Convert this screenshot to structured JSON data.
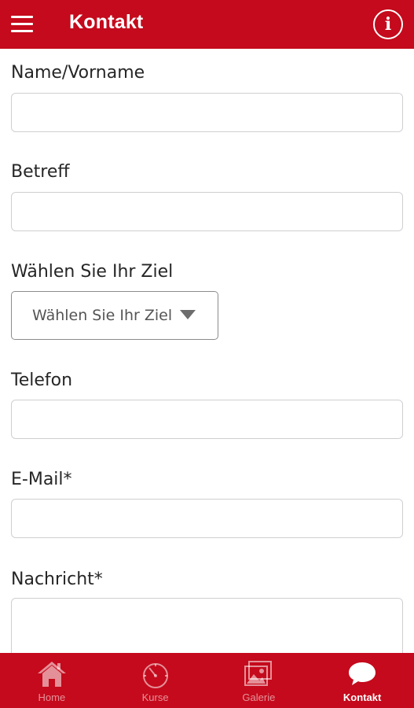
{
  "app_bar": {
    "title": "Kontakt"
  },
  "form": {
    "name_label": "Name/Vorname",
    "name_value": "",
    "subject_label": "Betreff",
    "subject_value": "",
    "destination_label": "Wählen Sie Ihr Ziel",
    "destination_selected": "Wählen Sie Ihr Ziel",
    "phone_label": "Telefon",
    "phone_value": "",
    "email_label": "E-Mail*",
    "email_value": "",
    "message_label": "Nachricht*",
    "message_value": ""
  },
  "bottom_nav": {
    "items": [
      {
        "label": "Home",
        "icon": "home-icon",
        "active": false
      },
      {
        "label": "Kurse",
        "icon": "stopwatch-icon",
        "active": false
      },
      {
        "label": "Galerie",
        "icon": "gallery-icon",
        "active": false
      },
      {
        "label": "Kontakt",
        "icon": "chat-bubble-icon",
        "active": true
      }
    ]
  },
  "colors": {
    "brand_red": "#c40a1c",
    "input_border": "#cfcfcf",
    "inactive_nav": "rgba(255,255,255,0.55)"
  }
}
